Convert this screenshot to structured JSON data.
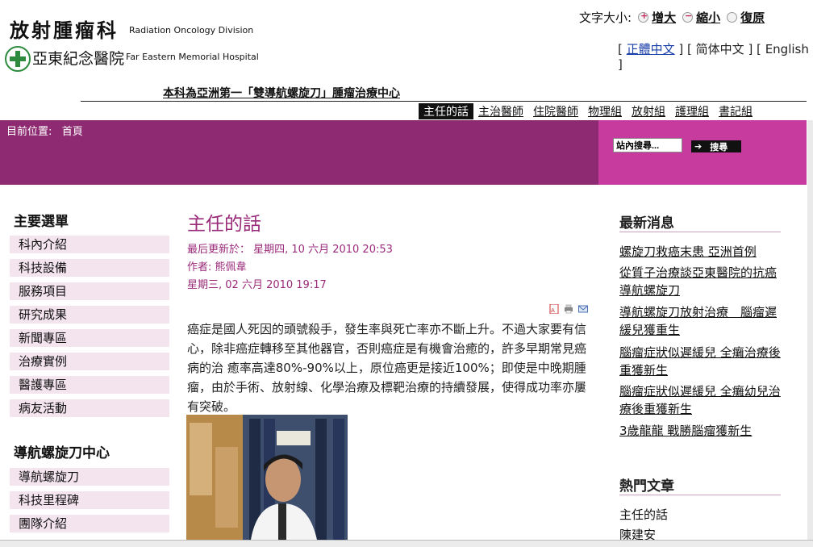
{
  "header": {
    "title_cn": "放射腫瘤科",
    "title_en": "Radiation Oncology Division",
    "hospital_cn": "亞東紀念醫院",
    "hospital_en": "Far Eastern Memorial Hospital"
  },
  "font_size": {
    "label": "文字大小:",
    "increase": "增大",
    "decrease": "縮小",
    "reset": "復原"
  },
  "languages": {
    "traditional": "正體中文",
    "simplified": "简体中文",
    "english": "English"
  },
  "banner": "本科為亞洲第一「雙導航螺旋刀」腫瘤治療中心",
  "top_nav": [
    "主任的話",
    "主治醫師",
    "住院醫師",
    "物理組",
    "放射組",
    "護理組",
    "書記組"
  ],
  "breadcrumb": {
    "label": "目前位置:",
    "home": "首頁"
  },
  "search": {
    "placeholder": "站內搜尋...",
    "button": "搜尋"
  },
  "main_menu": {
    "title": "主要選單",
    "items": [
      "科內介紹",
      "科技設備",
      "服務項目",
      "研究成果",
      "新聞專區",
      "治療實例",
      "醫護專區",
      "病友活動"
    ]
  },
  "tomo_menu": {
    "title": "導航螺旋刀中心",
    "items": [
      "導航螺旋刀",
      "科技里程碑",
      "團隊介紹"
    ]
  },
  "article": {
    "title": "主任的話",
    "updated": "最后更新於：  星期四, 10 六月 2010 20:53",
    "author": "作者: 熊佩韋",
    "date": "星期三, 02 六月 2010 19:17",
    "body": "癌症是國人死因的頭號殺手，發生率與死亡率亦不斷上升。不過大家要有信心，除非癌症轉移至其他器官，否則癌症是有機會治癒的，許多早期常見癌病的治 癒率高達80%-90%以上，原位癌更是接近100%；即使是中晚期腫瘤，由於手術、放射線、化學治療及標靶治療的持續發展，使得成功率亦屢有突破。"
  },
  "news": {
    "title": "最新消息",
    "items": [
      "螺旋刀救癌末患 亞洲首例",
      "從質子治療談亞東醫院的抗癌導航螺旋刀",
      "導航螺旋刀放射治療　腦瘤遲緩兒獲重生",
      "腦瘤症狀似遲緩兒 全癱治療後重獲新生",
      "腦瘤症狀似遲緩兒 全癱幼兒治療後重獲新生",
      "3歲龍龍 戰勝腦瘤獲新生"
    ]
  },
  "popular": {
    "title": "熱門文章",
    "items": [
      "主任的話",
      "陳建安"
    ]
  }
}
